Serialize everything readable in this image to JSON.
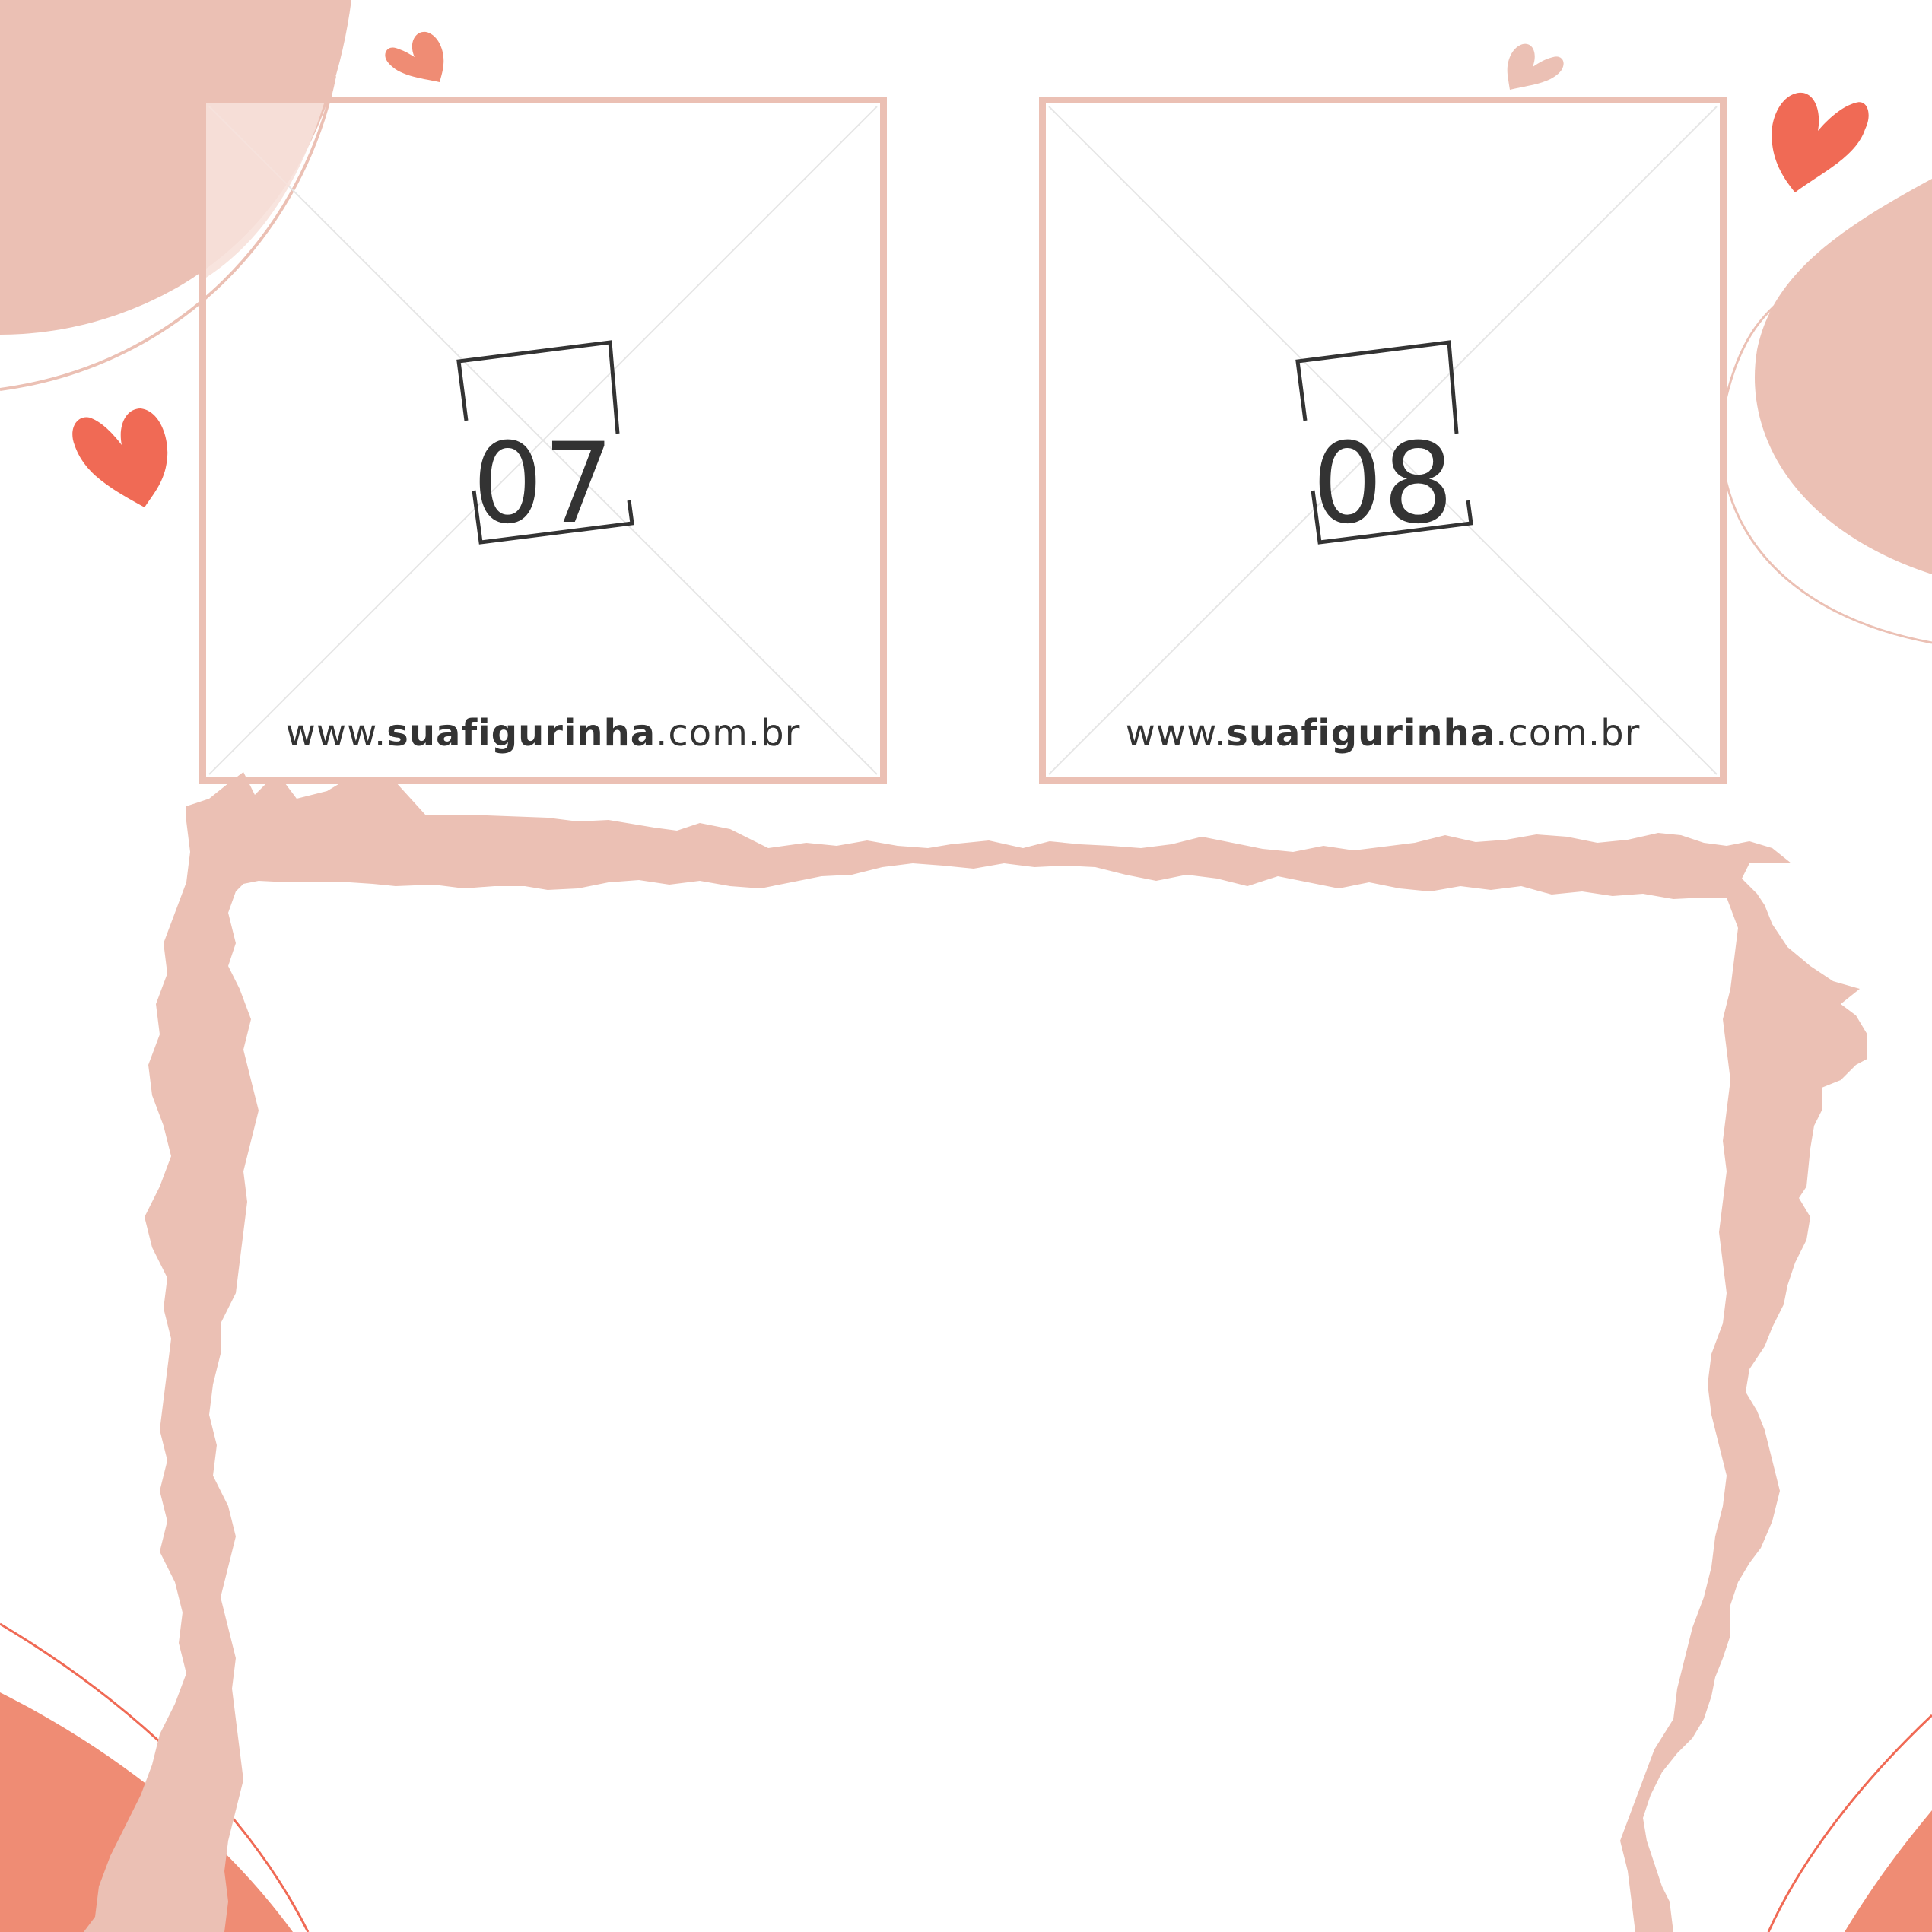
{
  "stickers": [
    {
      "number": "07",
      "url_prefix": "www.",
      "url_brand": "suafigurinha",
      "url_suffix": ".com.br"
    },
    {
      "number": "08",
      "url_prefix": "www.",
      "url_brand": "suafigurinha",
      "url_suffix": ".com.br"
    }
  ],
  "colors": {
    "blush": "#ebc0b4",
    "coral": "#f06a55",
    "salmon": "#ef8c74",
    "light_blush": "#f5dbd3",
    "text": "#333333"
  },
  "icons": [
    "heart-icon",
    "scribble-photo-frame"
  ]
}
